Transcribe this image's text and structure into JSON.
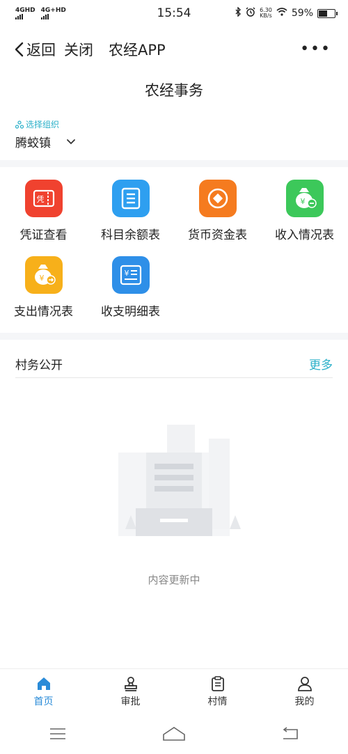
{
  "status_bar": {
    "signal1": "4GHD",
    "signal2": "4G+HD",
    "time": "15:54",
    "speed_value": "6.30",
    "speed_unit": "KB/s",
    "battery": "59%",
    "battery_level": 0.59
  },
  "nav": {
    "back_label": "返回",
    "close_label": "关闭",
    "title": "农经APP",
    "more_label": "•••"
  },
  "page_title": "农经事务",
  "org": {
    "caption": "选择组织",
    "value": "腾蛟镇"
  },
  "functions": [
    {
      "label": "凭证查看",
      "icon": "voucher-icon",
      "color": "#f0422f",
      "glyph": "凭"
    },
    {
      "label": "科目余额表",
      "icon": "list-icon",
      "color": "#2e9ff0",
      "glyph": ""
    },
    {
      "label": "货币资金表",
      "icon": "coin-icon",
      "color": "#f57b1f",
      "glyph": ""
    },
    {
      "label": "收入情况表",
      "icon": "income-bag-icon",
      "color": "#3cc85a",
      "glyph": "¥"
    },
    {
      "label": "支出情况表",
      "icon": "expense-bag-icon",
      "color": "#f7b01a",
      "glyph": "¥"
    },
    {
      "label": "收支明细表",
      "icon": "detail-sheet-icon",
      "color": "#2e8fe8",
      "glyph": "¥"
    }
  ],
  "village": {
    "title": "村务公开",
    "more_label": "更多",
    "empty_text": "内容更新中"
  },
  "tabs": [
    {
      "label": "首页",
      "icon": "home-icon",
      "active": true
    },
    {
      "label": "审批",
      "icon": "stamp-icon",
      "active": false
    },
    {
      "label": "村情",
      "icon": "clipboard-icon",
      "active": false
    },
    {
      "label": "我的",
      "icon": "user-icon",
      "active": false
    }
  ],
  "colors": {
    "accent": "#2bb0c9",
    "tab_active": "#2a8bd8"
  }
}
